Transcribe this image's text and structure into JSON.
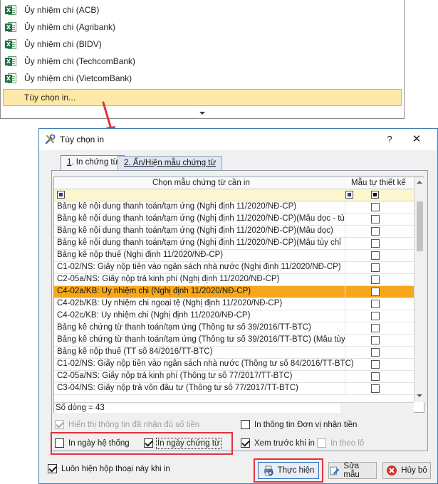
{
  "menu": {
    "items": [
      {
        "label": "Ủy nhiệm chi (ACB)",
        "icon": "excel-icon"
      },
      {
        "label": "Ủy nhiệm chi (Agribank)",
        "icon": "excel-icon"
      },
      {
        "label": "Ủy nhiệm chi (BIDV)",
        "icon": "excel-icon"
      },
      {
        "label": "Ủy nhiệm chi (TechcomBank)",
        "icon": "excel-icon"
      },
      {
        "label": "Ủy nhiệm chi (VietcomBank)",
        "icon": "excel-icon"
      }
    ],
    "highlighted_label": "Tùy chọn in..."
  },
  "dialog": {
    "title": "Tùy chọn in",
    "help": "?",
    "close": "✕",
    "tabs": [
      {
        "key": "1",
        "rest": ". In chứng từ"
      },
      {
        "key": "2",
        "rest": ". Ẩn/Hiện mẫu chứng từ"
      }
    ],
    "grid": {
      "col_template": "Chọn mẫu chứng từ cần in",
      "col_custom": "Mẫu tự thiết kế",
      "rows": [
        "Bảng kê nội dung thanh toán/tạm ứng (Nghị định 11/2020/NĐ-CP)",
        "Bảng kê nội dung thanh toán/tạm ứng (Nghị định 11/2020/NĐ-CP)(Mẫu dọc - tù",
        "Bảng kê nội dung thanh toán/tạm ứng (Nghị định 11/2020/NĐ-CP)(Mẫu dọc)",
        "Bảng kê nội dung thanh toán/tạm ứng (Nghị định 11/2020/NĐ-CP)(Mẫu tùy chỉ",
        "Bảng kê nộp thuế (Nghị định 11/2020/NĐ-CP)",
        "C1-02/NS: Giấy nộp tiền vào ngân sách nhà nước (Nghị định 11/2020/NĐ-CP)",
        "C2-05a/NS: Giấy nộp trả kinh phí (Nghị định 11/2020/NĐ-CP)",
        "C4-02a/KB: Ủy nhiệm chi (Nghị định 11/2020/NĐ-CP)",
        "C4-02b/KB: Ủy nhiệm chi ngoại tệ (Nghị định 11/2020/NĐ-CP)",
        "C4-02c/KB: Ủy nhiệm chi (Nghị định 11/2020/NĐ-CP)",
        "Bảng kê chứng từ thanh toán/tạm ứng (Thông tư số 39/2016/TT-BTC)",
        "Bảng kê chứng từ thanh toán/tạm ứng (Thông tư số 39/2016/TT-BTC) (Mẫu tùy",
        "Bảng kê nộp thuế (TT số 84/2016/TT-BTC)",
        "C1-02/NS: Giấy nộp tiền vào ngân sách nhà nước (Thông tư số 84/2016/TT-BTC)",
        "C2-05a/NS: Giấy nộp trả kinh phí (Thông tư số 77/2017/TT-BTC)",
        "C3-04/NS: Giấy nộp trả vốn đầu tư (Thông tư số 77/2017/TT-BTC)"
      ],
      "selected_index": 7,
      "row_count": "Số dòng = 43"
    },
    "options": {
      "show_full_info": "Hiển thị thông tin đã nhận đủ số tiền",
      "print_recipient": "In thông tin Đơn vị nhận tiền",
      "print_system_date": "In ngày hệ thống",
      "print_voucher_date": "In ngày chứng từ",
      "preview_before_print": "Xem trước khi in",
      "print_by_lot": "In theo lô",
      "always_show": "Luôn hiện hộp thoại này khi in"
    },
    "buttons": {
      "execute": "Thực hiện",
      "edit_template": "Sửa mẫu",
      "cancel": "Hủy bỏ"
    }
  }
}
